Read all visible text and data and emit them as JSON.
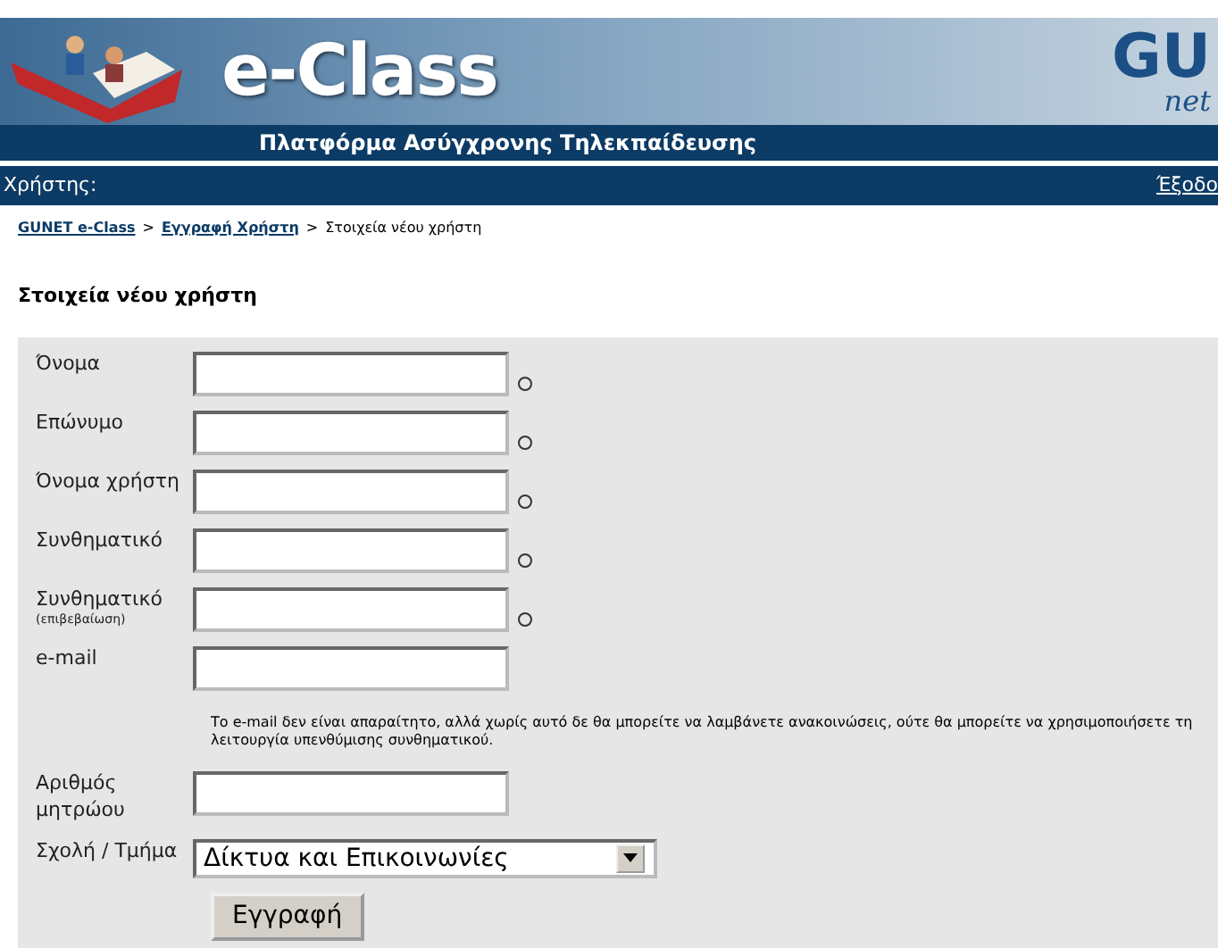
{
  "header": {
    "logo_text": "e-Class",
    "subtitle": "Πλατφόρμα Ασύγχρονης Τηλεκπαίδευσης",
    "partner_logo": {
      "top": "GU",
      "bottom": "net"
    }
  },
  "user_bar": {
    "label": "Χρήστης:",
    "logout": "Έξοδο"
  },
  "breadcrumb": [
    {
      "label": "GUNET e-Class",
      "separator": ">"
    },
    {
      "label": "Εγγραφή Χρήστη",
      "separator": ">"
    },
    {
      "label": "Στοιχεία νέου χρήστη"
    }
  ],
  "page_title": "Στοιχεία νέου χρήστη",
  "form": {
    "fields": [
      {
        "kind": "text",
        "label": "Όνομα",
        "required": true
      },
      {
        "kind": "text",
        "label": "Επώνυμο",
        "required": true
      },
      {
        "kind": "text",
        "label": "Όνομα χρήστη",
        "required": true
      },
      {
        "kind": "text",
        "label": "Συνθηματικό",
        "required": true
      },
      {
        "kind": "text",
        "label": "Συνθηματικό",
        "sublabel": "(επιβεβαίωση)",
        "required": true
      },
      {
        "kind": "text",
        "label": "e-mail",
        "required": false,
        "note": "Το e-mail δεν είναι απαραίτητο, αλλά χωρίς αυτό δε θα μπορείτε να λαμβάνετε ανακοινώσεις, ούτε θα μπορείτε να χρησιμοποιήσετε τη λειτουργία υπενθύμισης συνθηματικού."
      },
      {
        "kind": "text",
        "label": "Αριθμός μητρώου",
        "required": false
      },
      {
        "kind": "select",
        "label": "Σχολή / Τμήμα",
        "value": "Δίκτυα και Επικοινωνίες",
        "required": false
      }
    ],
    "submit": "Εγγραφή"
  }
}
